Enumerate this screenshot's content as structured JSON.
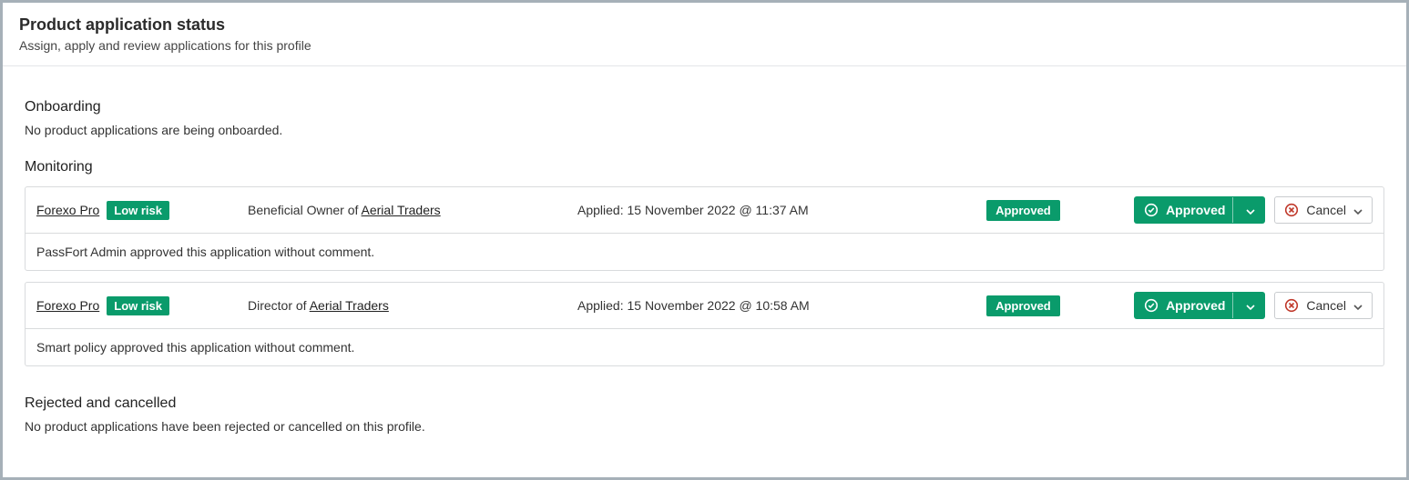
{
  "header": {
    "title": "Product application status",
    "subtitle": "Assign, apply and review applications for this profile"
  },
  "sections": {
    "onboarding": {
      "title": "Onboarding",
      "empty": "No product applications are being onboarded."
    },
    "monitoring": {
      "title": "Monitoring",
      "items": [
        {
          "product": "Forexo Pro",
          "risk": "Low risk",
          "role_prefix": "Beneficial Owner of ",
          "role_link": "Aerial Traders",
          "applied_prefix": "Applied: ",
          "applied_value": "15 November 2022 @ 11:37 AM",
          "status": "Approved",
          "action_approved": "Approved",
          "action_cancel": "Cancel",
          "note": "PassFort Admin approved this application without comment."
        },
        {
          "product": "Forexo Pro",
          "risk": "Low risk",
          "role_prefix": "Director of ",
          "role_link": "Aerial Traders",
          "applied_prefix": "Applied: ",
          "applied_value": "15 November 2022 @ 10:58 AM",
          "status": "Approved",
          "action_approved": "Approved",
          "action_cancel": "Cancel",
          "note": "Smart policy approved this application without comment."
        }
      ]
    },
    "rejected": {
      "title": "Rejected and cancelled",
      "empty": "No product applications have been rejected or cancelled on this profile."
    }
  },
  "colors": {
    "accent": "#0a9b6b",
    "danger": "#c0392b"
  }
}
